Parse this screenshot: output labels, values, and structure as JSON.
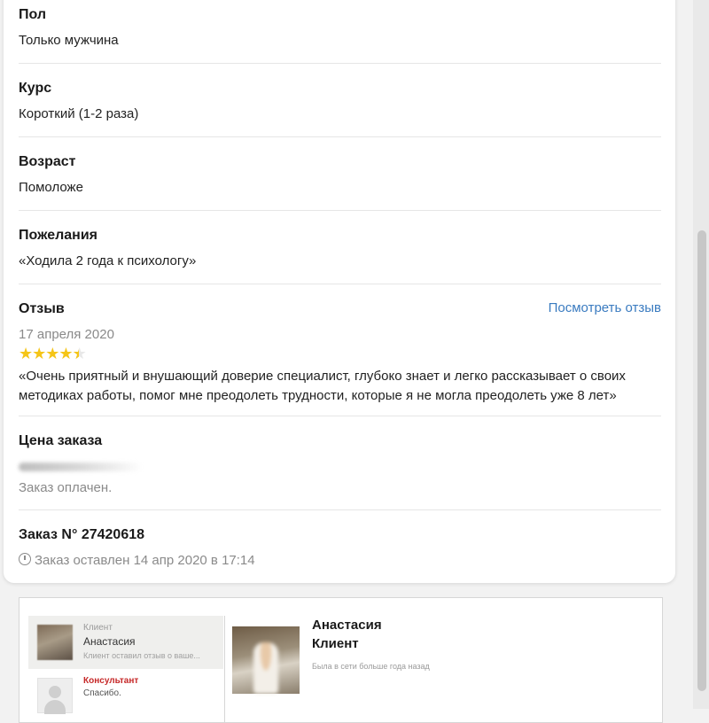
{
  "fields": {
    "gender": {
      "label": "Пол",
      "value": "Только мужчина"
    },
    "course": {
      "label": "Курс",
      "value": "Короткий (1-2 раза)"
    },
    "age": {
      "label": "Возраст",
      "value": "Помоложе"
    },
    "wishes": {
      "label": "Пожелания",
      "value": "«Ходила 2 года к психологу»"
    }
  },
  "review": {
    "label": "Отзыв",
    "view_link": "Посмотреть отзыв",
    "date": "17 апреля 2020",
    "rating": 4.5,
    "rating_max": 5,
    "text_line1": "«Очень приятный и внушающий доверие специалист, глубоко знает и легко рассказывает о своих",
    "text_line2": "методиках работы, помог мне преодолеть трудности, которые я не могла преодолеть уже 8 лет»"
  },
  "price": {
    "label": "Цена заказа",
    "status": "Заказ оплачен."
  },
  "order": {
    "title": "Заказ N° 27420618",
    "placed": "Заказ оставлен 14 апр 2020 в 17:14"
  },
  "chat": {
    "items": [
      {
        "role": "Клиент",
        "name": "Анастасия",
        "preview": "Клиент оставил отзыв о ваше..."
      },
      {
        "role": "Консультант",
        "name": "Спасибо.",
        "preview": ""
      }
    ],
    "header": {
      "name": "Анастасия",
      "role": "Клиент",
      "status": "Была в сети больше года назад"
    }
  },
  "colors": {
    "link": "#3a7bc0",
    "star": "#f5c518",
    "consultant_role": "#c62828"
  }
}
